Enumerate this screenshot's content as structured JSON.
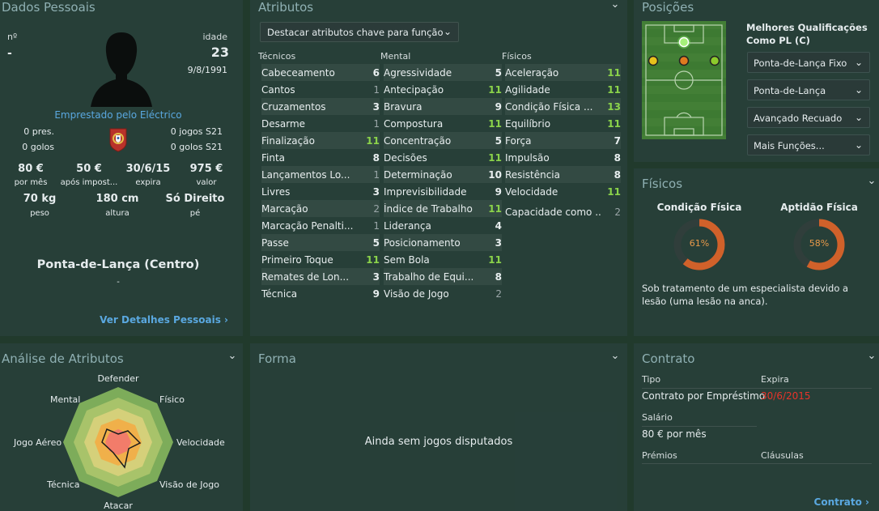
{
  "personal": {
    "title": "Dados Pessoais",
    "num_label": "nº",
    "num_value": "-",
    "age_label": "idade",
    "age_value": "23",
    "dob": "9/8/1991",
    "loan_text": "Emprestado pelo Eléctrico",
    "apps": "0 pres.",
    "goals": "0 golos",
    "s21_apps": "0 jogos S21",
    "s21_goals": "0 golos S21",
    "wage_value": "80 €",
    "wage_label": "por mês",
    "after_tax_value": "50 €",
    "after_tax_label": "após impost...",
    "expires_value": "30/6/15",
    "expires_label": "expira",
    "market_value": "975 €",
    "market_label": "valor",
    "weight_value": "70 kg",
    "weight_label": "peso",
    "height_value": "180 cm",
    "height_label": "altura",
    "foot_value": "Só Direito",
    "foot_label": "pé",
    "position": "Ponta-de-Lança (Centro)",
    "position_sub": "-",
    "details_link": "Ver Detalhes Pessoais",
    "nationality_icon": "portugal-flag-icon"
  },
  "attributes": {
    "title": "Atributos",
    "highlight_dropdown": "Destacar atributos chave para função",
    "technical_header": "Técnicos",
    "mental_header": "Mental",
    "physical_header": "Físicos",
    "technical": [
      {
        "name": "Cabeceamento",
        "value": "6"
      },
      {
        "name": "Cantos",
        "value": "1"
      },
      {
        "name": "Cruzamentos",
        "value": "3"
      },
      {
        "name": "Desarme",
        "value": "1"
      },
      {
        "name": "Finalização",
        "value": "11"
      },
      {
        "name": "Finta",
        "value": "8"
      },
      {
        "name": "Lançamentos Lo...",
        "value": "1"
      },
      {
        "name": "Livres",
        "value": "3"
      },
      {
        "name": "Marcação",
        "value": "2"
      },
      {
        "name": "Marcação Penalti...",
        "value": "1"
      },
      {
        "name": "Passe",
        "value": "5"
      },
      {
        "name": "Primeiro Toque",
        "value": "11"
      },
      {
        "name": "Remates de Lon...",
        "value": "3"
      },
      {
        "name": "Técnica",
        "value": "9"
      }
    ],
    "mental": [
      {
        "name": "Agressividade",
        "value": "5"
      },
      {
        "name": "Antecipação",
        "value": "11"
      },
      {
        "name": "Bravura",
        "value": "9"
      },
      {
        "name": "Compostura",
        "value": "11"
      },
      {
        "name": "Concentração",
        "value": "5"
      },
      {
        "name": "Decisões",
        "value": "11"
      },
      {
        "name": "Determinação",
        "value": "10"
      },
      {
        "name": "Imprevisibilidade",
        "value": "9"
      },
      {
        "name": "Índice de Trabalho",
        "value": "11"
      },
      {
        "name": "Liderança",
        "value": "4"
      },
      {
        "name": "Posicionamento",
        "value": "3"
      },
      {
        "name": "Sem Bola",
        "value": "11"
      },
      {
        "name": "Trabalho de Equi...",
        "value": "8"
      },
      {
        "name": "Visão de Jogo",
        "value": "2"
      }
    ],
    "physical": [
      {
        "name": "Aceleração",
        "value": "11"
      },
      {
        "name": "Agilidade",
        "value": "11"
      },
      {
        "name": "Condição Física ...",
        "value": "13"
      },
      {
        "name": "Equilíbrio",
        "value": "11"
      },
      {
        "name": "Força",
        "value": "7"
      },
      {
        "name": "Impulsão",
        "value": "8"
      },
      {
        "name": "Resistência",
        "value": "8"
      },
      {
        "name": "Velocidade",
        "value": "11"
      }
    ],
    "extra": {
      "name": "Capacidade como ...",
      "value": "2"
    }
  },
  "positions": {
    "title": "Posições",
    "best_title": "Melhores Qualificações",
    "best_subtitle": "Como PL (C)",
    "roles": [
      "Ponta-de-Lança Fixo",
      "Ponta-de-Lança",
      "Avançado Recuado",
      "Mais Funções..."
    ]
  },
  "physicals": {
    "title": "Físicos",
    "condition_label": "Condição Física",
    "condition_value": "61%",
    "condition_pct": 61,
    "fitness_label": "Aptidão Física",
    "fitness_value": "58%",
    "fitness_pct": 58,
    "injury_text": "Sob tratamento de um especialista devido a lesão (uma lesão na anca)."
  },
  "analysis": {
    "title": "Análise de Atributos",
    "axes": [
      "Defender",
      "Físico",
      "Velocidade",
      "Visão de Jogo",
      "Atacar",
      "Técnica",
      "Jogo Aéreo",
      "Mental"
    ]
  },
  "form": {
    "title": "Forma",
    "empty_text": "Ainda sem jogos disputados"
  },
  "contract": {
    "title": "Contrato",
    "type_label": "Tipo",
    "type_value": "Contrato por Empréstimo",
    "expires_label": "Expira",
    "expires_value": "30/6/2015",
    "salary_label": "Salário",
    "salary_value": "80 € por mês",
    "bonuses_label": "Prémios",
    "clauses_label": "Cláusulas",
    "link": "Contrato"
  },
  "colors": {
    "green_value": "#8bd34a",
    "link_blue": "#5aa8e0",
    "expiry_red": "#e8332a",
    "ring_orange": "#d0612a"
  }
}
